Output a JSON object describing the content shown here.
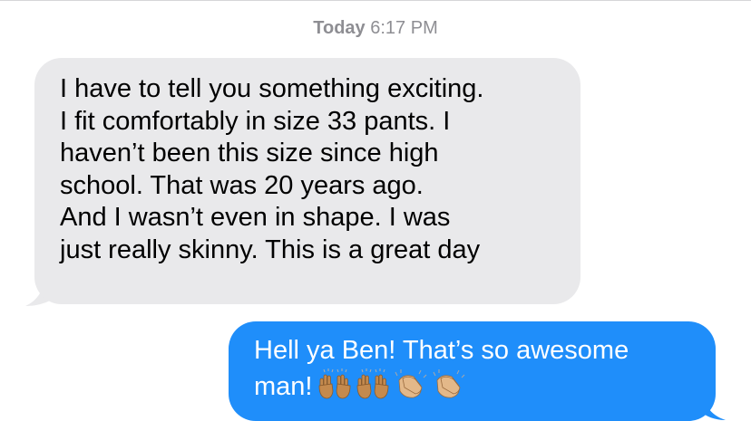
{
  "conversation": {
    "timestamp_day": "Today",
    "timestamp_time": "6:17 PM",
    "incoming_text": "I have to tell you something exciting.\nI fit comfortably in size 33 pants.  I\nhaven’t been this size since high\nschool.  That was 20 years ago.\nAnd I wasn’t even in shape.  I was\njust really skinny.  This is a great day",
    "outgoing_text": "Hell ya Ben! That’s so awesome\nman!",
    "outgoing_emojis": [
      "raising-hands-icon",
      "raising-hands-icon",
      "clapping-hands-icon",
      "clapping-hands-icon"
    ]
  },
  "colors": {
    "incoming_bubble": "#e9e9eb",
    "outgoing_bubble": "#1f8efa",
    "timestamp": "#8e8e93"
  }
}
